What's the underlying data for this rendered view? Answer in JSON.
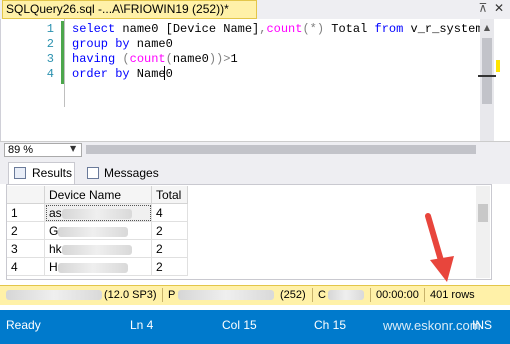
{
  "tab": {
    "title": "SQLQuery26.sql -...A\\FRIOWIN19 (252))*",
    "pin_icon": "pin-icon",
    "close_icon": "close-icon"
  },
  "editor": {
    "line_numbers": [
      "1",
      "2",
      "3",
      "4"
    ],
    "lines": [
      "select name0 [Device Name],count(*) Total from v_r_system",
      "group by name0",
      "having (count(name0))>1",
      "order by Name0"
    ]
  },
  "zoom": {
    "value": "89 %"
  },
  "results_tabs": [
    {
      "label": "Results",
      "icon": "grid-icon"
    },
    {
      "label": "Messages",
      "icon": "messages-icon"
    }
  ],
  "grid": {
    "columns": [
      "Device Name",
      "Total"
    ],
    "rows": [
      {
        "num": "1",
        "name": "as",
        "total": "4"
      },
      {
        "num": "2",
        "name": "G",
        "total": "2"
      },
      {
        "num": "3",
        "name": "hk",
        "total": "2"
      },
      {
        "num": "4",
        "name": "H",
        "total": "2"
      }
    ]
  },
  "query_status": {
    "server_version": "(12.0 SP3)",
    "server_prefix": "P",
    "spid": "(252)",
    "db_prefix": "C",
    "elapsed": "00:00:00",
    "rows": "401 rows"
  },
  "main_status": {
    "ready": "Ready",
    "ln": "Ln 4",
    "col": "Col 15",
    "ch": "Ch 15",
    "ins": "INS"
  },
  "watermark": "www.eskonr.com",
  "colors": {
    "status_blue": "#007acc",
    "query_bar": "#fff1a8",
    "arrow": "#e8453c"
  }
}
